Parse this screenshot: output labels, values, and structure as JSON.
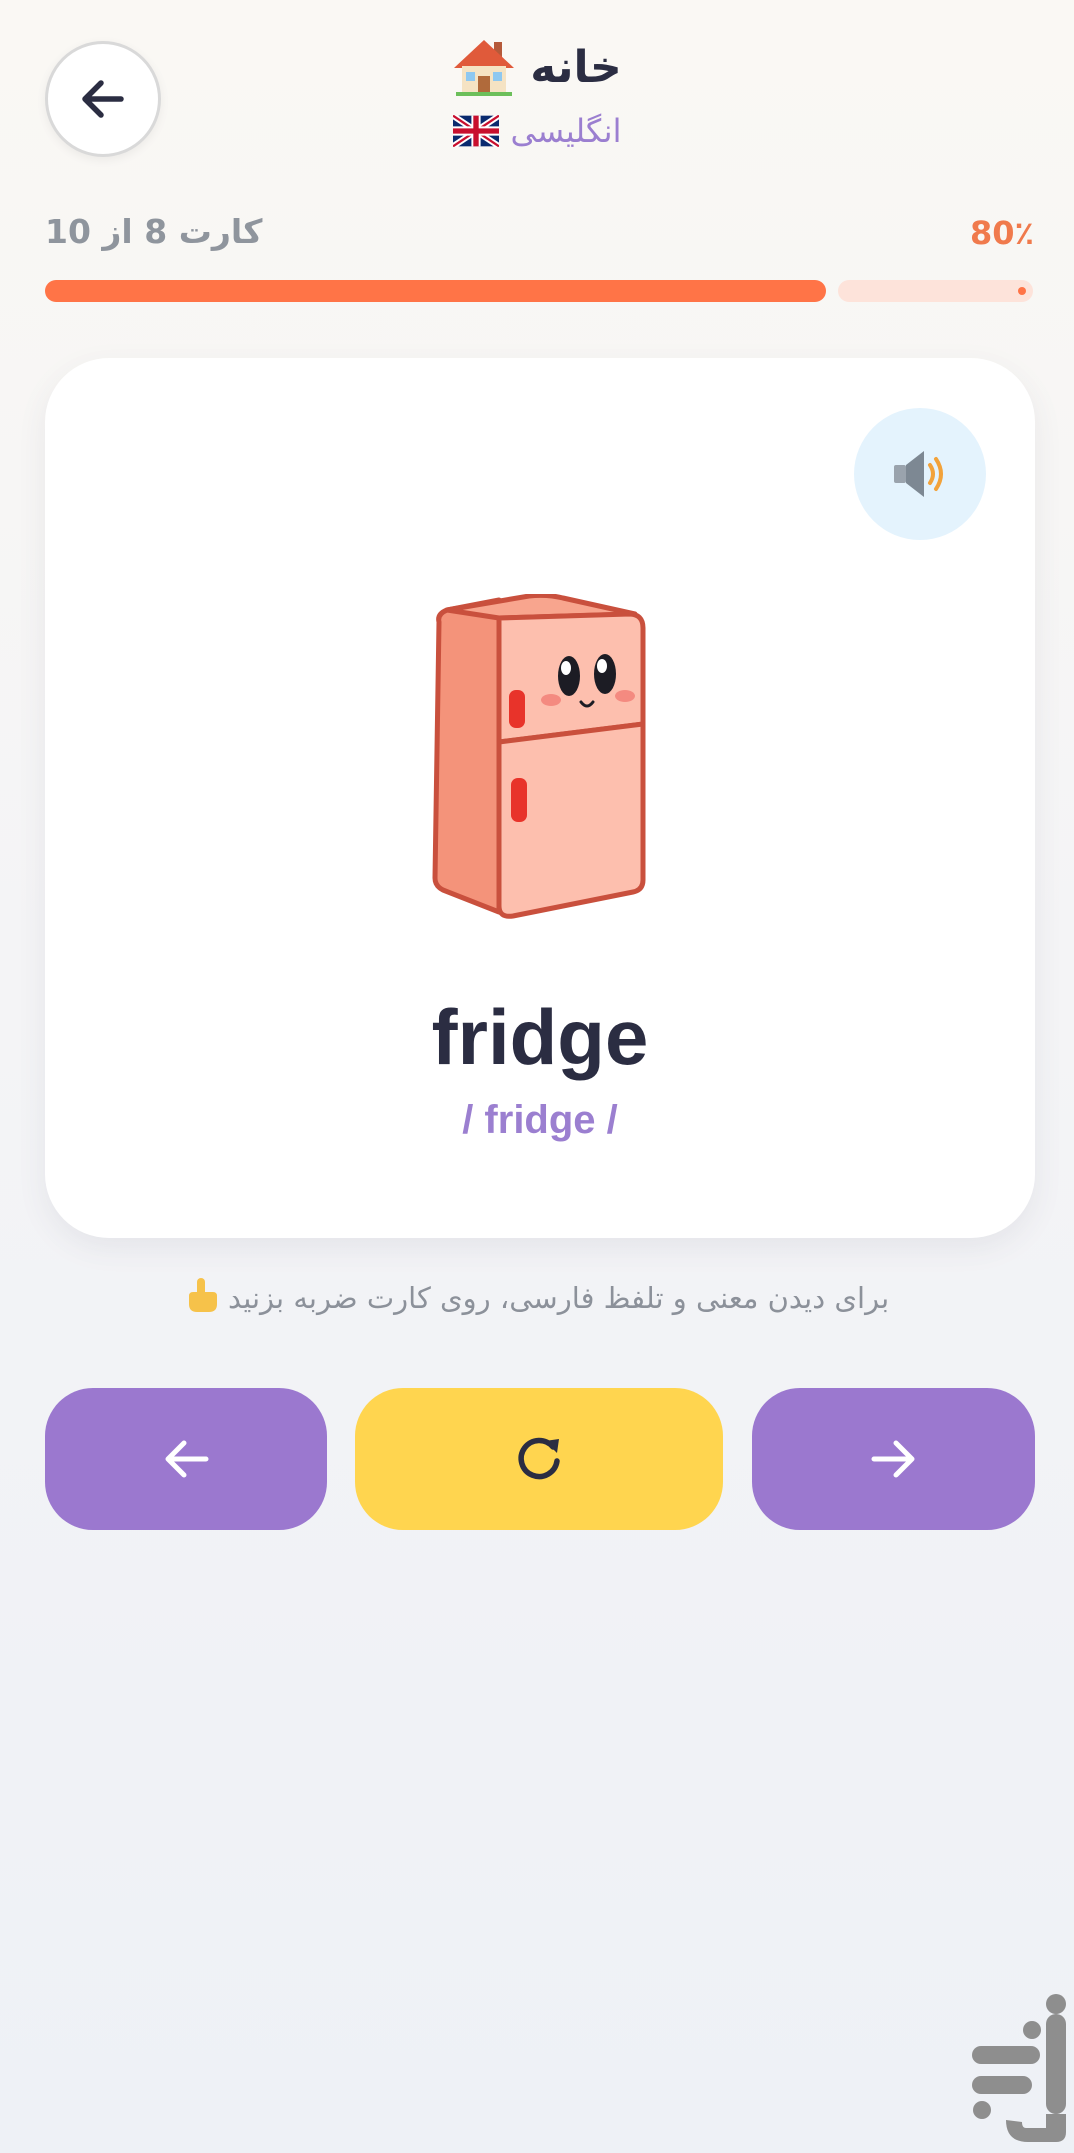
{
  "header": {
    "title": "خانه",
    "title_icon": "house-emoji",
    "language": "انگلیسی",
    "language_flag": "uk-flag-icon",
    "back_icon": "arrow-left-icon"
  },
  "progress": {
    "label": "کارت 8 از 10",
    "percent_label": "80٪",
    "current": 8,
    "total": 10,
    "fraction": 0.8
  },
  "card": {
    "word": "fridge",
    "phonetic": "/ fridge /",
    "image": "fridge-icon",
    "sound_icon": "speaker-icon"
  },
  "hint": {
    "text": "برای دیدن معنی و تلفظ فارسی، روی کارت ضربه بزنید",
    "icon": "pointing-hand-emoji"
  },
  "buttons": {
    "prev_icon": "arrow-left-icon",
    "flip_icon": "refresh-icon",
    "next_icon": "arrow-right-icon"
  },
  "colors": {
    "accent_orange": "#ff7447",
    "purple": "#9b78cf",
    "yellow": "#ffd54f",
    "sound_bg": "#e4f3fd"
  }
}
